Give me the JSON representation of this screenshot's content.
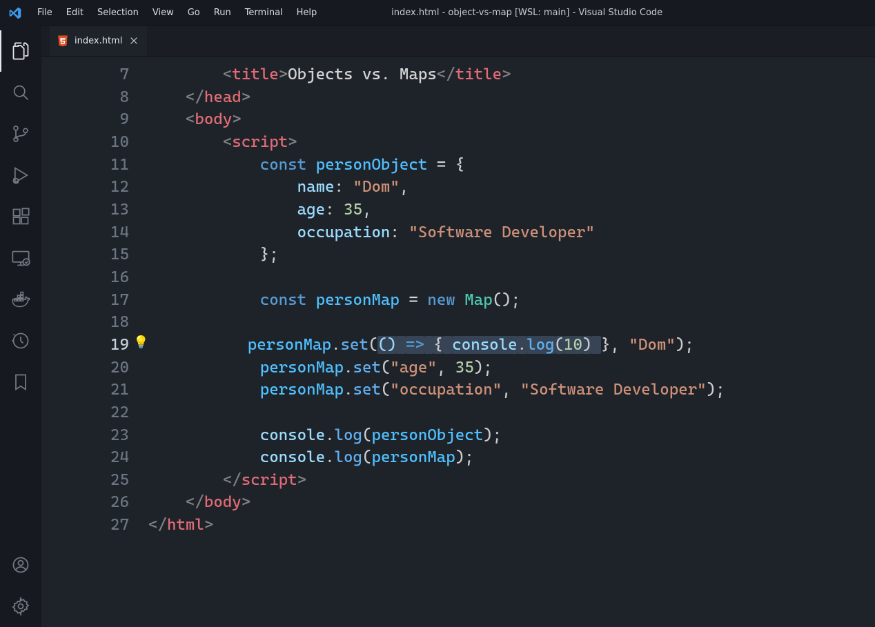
{
  "window": {
    "title": "index.html - object-vs-map [WSL: main] - Visual Studio Code"
  },
  "menus": [
    "File",
    "Edit",
    "Selection",
    "View",
    "Go",
    "Run",
    "Terminal",
    "Help"
  ],
  "activity_bar": [
    {
      "name": "explorer-icon",
      "active": true
    },
    {
      "name": "search-icon"
    },
    {
      "name": "source-control-icon"
    },
    {
      "name": "run-debug-icon"
    },
    {
      "name": "extensions-icon"
    },
    {
      "name": "remote-explorer-icon"
    },
    {
      "name": "docker-icon"
    },
    {
      "name": "timeline-icon"
    },
    {
      "name": "bookmarks-icon"
    }
  ],
  "activity_bottom": [
    {
      "name": "accounts-icon"
    },
    {
      "name": "settings-gear-icon"
    }
  ],
  "tab": {
    "filename": "index.html"
  },
  "code": {
    "lines": [
      {
        "n": 7,
        "tokens": [
          {
            "txt": "        ",
            "cls": ""
          },
          {
            "txt": "<",
            "cls": "t-br"
          },
          {
            "txt": "title",
            "cls": "t-tag"
          },
          {
            "txt": ">",
            "cls": "t-br"
          },
          {
            "txt": "Objects vs. Maps",
            "cls": "t-txt"
          },
          {
            "txt": "</",
            "cls": "t-br"
          },
          {
            "txt": "title",
            "cls": "t-tag"
          },
          {
            "txt": ">",
            "cls": "t-br"
          }
        ]
      },
      {
        "n": 8,
        "tokens": [
          {
            "txt": "    ",
            "cls": ""
          },
          {
            "txt": "</",
            "cls": "t-br"
          },
          {
            "txt": "head",
            "cls": "t-tag"
          },
          {
            "txt": ">",
            "cls": "t-br"
          }
        ]
      },
      {
        "n": 9,
        "tokens": [
          {
            "txt": "    ",
            "cls": ""
          },
          {
            "txt": "<",
            "cls": "t-br"
          },
          {
            "txt": "body",
            "cls": "t-tag"
          },
          {
            "txt": ">",
            "cls": "t-br"
          }
        ]
      },
      {
        "n": 10,
        "tokens": [
          {
            "txt": "        ",
            "cls": ""
          },
          {
            "txt": "<",
            "cls": "t-br"
          },
          {
            "txt": "script",
            "cls": "t-tag"
          },
          {
            "txt": ">",
            "cls": "t-br"
          }
        ]
      },
      {
        "n": 11,
        "tokens": [
          {
            "txt": "            ",
            "cls": ""
          },
          {
            "txt": "const",
            "cls": "t-kw"
          },
          {
            "txt": " ",
            "cls": ""
          },
          {
            "txt": "personObject",
            "cls": "t-const"
          },
          {
            "txt": " ",
            "cls": ""
          },
          {
            "txt": "=",
            "cls": "t-op"
          },
          {
            "txt": " ",
            "cls": ""
          },
          {
            "txt": "{",
            "cls": "t-pu"
          }
        ]
      },
      {
        "n": 12,
        "tokens": [
          {
            "txt": "                ",
            "cls": ""
          },
          {
            "txt": "name",
            "cls": "t-id"
          },
          {
            "txt": ":",
            "cls": "t-pu"
          },
          {
            "txt": " ",
            "cls": ""
          },
          {
            "txt": "\"Dom\"",
            "cls": "t-str"
          },
          {
            "txt": ",",
            "cls": "t-pu"
          }
        ]
      },
      {
        "n": 13,
        "tokens": [
          {
            "txt": "                ",
            "cls": ""
          },
          {
            "txt": "age",
            "cls": "t-id"
          },
          {
            "txt": ":",
            "cls": "t-pu"
          },
          {
            "txt": " ",
            "cls": ""
          },
          {
            "txt": "35",
            "cls": "t-num"
          },
          {
            "txt": ",",
            "cls": "t-pu"
          }
        ]
      },
      {
        "n": 14,
        "tokens": [
          {
            "txt": "                ",
            "cls": ""
          },
          {
            "txt": "occupation",
            "cls": "t-id"
          },
          {
            "txt": ":",
            "cls": "t-pu"
          },
          {
            "txt": " ",
            "cls": ""
          },
          {
            "txt": "\"Software Developer\"",
            "cls": "t-str"
          }
        ]
      },
      {
        "n": 15,
        "tokens": [
          {
            "txt": "            ",
            "cls": ""
          },
          {
            "txt": "}",
            "cls": "t-pu"
          },
          {
            "txt": ";",
            "cls": "t-pu"
          }
        ]
      },
      {
        "n": 16,
        "tokens": [
          {
            "txt": "",
            "cls": ""
          }
        ]
      },
      {
        "n": 17,
        "tokens": [
          {
            "txt": "            ",
            "cls": ""
          },
          {
            "txt": "const",
            "cls": "t-kw"
          },
          {
            "txt": " ",
            "cls": ""
          },
          {
            "txt": "personMap",
            "cls": "t-const"
          },
          {
            "txt": " ",
            "cls": ""
          },
          {
            "txt": "=",
            "cls": "t-op"
          },
          {
            "txt": " ",
            "cls": ""
          },
          {
            "txt": "new",
            "cls": "t-kw"
          },
          {
            "txt": " ",
            "cls": ""
          },
          {
            "txt": "Map",
            "cls": "t-type"
          },
          {
            "txt": "()",
            "cls": "t-pu"
          },
          {
            "txt": ";",
            "cls": "t-pu"
          }
        ]
      },
      {
        "n": 18,
        "tokens": [
          {
            "txt": "",
            "cls": ""
          }
        ]
      },
      {
        "n": 19,
        "current": true,
        "bulb": true,
        "tokens": [
          {
            "txt": "            ",
            "cls": ""
          },
          {
            "txt": "personMap",
            "cls": "t-const"
          },
          {
            "txt": ".",
            "cls": "t-pu"
          },
          {
            "txt": "set",
            "cls": "t-func"
          },
          {
            "txt": "(",
            "cls": "t-pu"
          },
          {
            "txt": "()",
            "cls": "t-id",
            "hl": true
          },
          {
            "txt": " ",
            "cls": "",
            "hl": true
          },
          {
            "txt": "=>",
            "cls": "t-kw",
            "hl": true
          },
          {
            "txt": " ",
            "cls": "",
            "hl": true
          },
          {
            "txt": "{",
            "cls": "t-pu",
            "hl": true
          },
          {
            "txt": " ",
            "cls": "",
            "hl": true
          },
          {
            "txt": "console",
            "cls": "t-id",
            "hl": true
          },
          {
            "txt": ".",
            "cls": "t-pu",
            "hl": true
          },
          {
            "txt": "log",
            "cls": "t-func",
            "hl": true
          },
          {
            "txt": "(",
            "cls": "t-pu",
            "hl": true
          },
          {
            "txt": "10",
            "cls": "t-num",
            "hl": true
          },
          {
            "txt": ")",
            "cls": "t-pu",
            "hl": true
          },
          {
            "txt": " ",
            "cls": "",
            "hl": true
          },
          {
            "txt": "}",
            "cls": "t-pu"
          },
          {
            "txt": ",",
            "cls": "t-pu"
          },
          {
            "txt": " ",
            "cls": ""
          },
          {
            "txt": "\"Dom\"",
            "cls": "t-str"
          },
          {
            "txt": ")",
            "cls": "t-pu"
          },
          {
            "txt": ";",
            "cls": "t-pu"
          }
        ]
      },
      {
        "n": 20,
        "tokens": [
          {
            "txt": "            ",
            "cls": ""
          },
          {
            "txt": "personMap",
            "cls": "t-const"
          },
          {
            "txt": ".",
            "cls": "t-pu"
          },
          {
            "txt": "set",
            "cls": "t-func"
          },
          {
            "txt": "(",
            "cls": "t-pu"
          },
          {
            "txt": "\"age\"",
            "cls": "t-str"
          },
          {
            "txt": ",",
            "cls": "t-pu"
          },
          {
            "txt": " ",
            "cls": ""
          },
          {
            "txt": "35",
            "cls": "t-num"
          },
          {
            "txt": ")",
            "cls": "t-pu"
          },
          {
            "txt": ";",
            "cls": "t-pu"
          }
        ]
      },
      {
        "n": 21,
        "tokens": [
          {
            "txt": "            ",
            "cls": ""
          },
          {
            "txt": "personMap",
            "cls": "t-const"
          },
          {
            "txt": ".",
            "cls": "t-pu"
          },
          {
            "txt": "set",
            "cls": "t-func"
          },
          {
            "txt": "(",
            "cls": "t-pu"
          },
          {
            "txt": "\"occupation\"",
            "cls": "t-str"
          },
          {
            "txt": ",",
            "cls": "t-pu"
          },
          {
            "txt": " ",
            "cls": ""
          },
          {
            "txt": "\"Software Developer\"",
            "cls": "t-str"
          },
          {
            "txt": ")",
            "cls": "t-pu"
          },
          {
            "txt": ";",
            "cls": "t-pu"
          }
        ]
      },
      {
        "n": 22,
        "tokens": [
          {
            "txt": "",
            "cls": ""
          }
        ]
      },
      {
        "n": 23,
        "tokens": [
          {
            "txt": "            ",
            "cls": ""
          },
          {
            "txt": "console",
            "cls": "t-id"
          },
          {
            "txt": ".",
            "cls": "t-pu"
          },
          {
            "txt": "log",
            "cls": "t-func"
          },
          {
            "txt": "(",
            "cls": "t-pu"
          },
          {
            "txt": "personObject",
            "cls": "t-const"
          },
          {
            "txt": ")",
            "cls": "t-pu"
          },
          {
            "txt": ";",
            "cls": "t-pu"
          }
        ]
      },
      {
        "n": 24,
        "tokens": [
          {
            "txt": "            ",
            "cls": ""
          },
          {
            "txt": "console",
            "cls": "t-id"
          },
          {
            "txt": ".",
            "cls": "t-pu"
          },
          {
            "txt": "log",
            "cls": "t-func"
          },
          {
            "txt": "(",
            "cls": "t-pu"
          },
          {
            "txt": "personMap",
            "cls": "t-const"
          },
          {
            "txt": ")",
            "cls": "t-pu"
          },
          {
            "txt": ";",
            "cls": "t-pu"
          }
        ]
      },
      {
        "n": 25,
        "tokens": [
          {
            "txt": "        ",
            "cls": ""
          },
          {
            "txt": "</",
            "cls": "t-br"
          },
          {
            "txt": "script",
            "cls": "t-tag"
          },
          {
            "txt": ">",
            "cls": "t-br"
          }
        ]
      },
      {
        "n": 26,
        "tokens": [
          {
            "txt": "    ",
            "cls": ""
          },
          {
            "txt": "</",
            "cls": "t-br"
          },
          {
            "txt": "body",
            "cls": "t-tag"
          },
          {
            "txt": ">",
            "cls": "t-br"
          }
        ]
      },
      {
        "n": 27,
        "tokens": [
          {
            "txt": "</",
            "cls": "t-br"
          },
          {
            "txt": "html",
            "cls": "t-tag"
          },
          {
            "txt": ">",
            "cls": "t-br"
          }
        ]
      }
    ]
  }
}
